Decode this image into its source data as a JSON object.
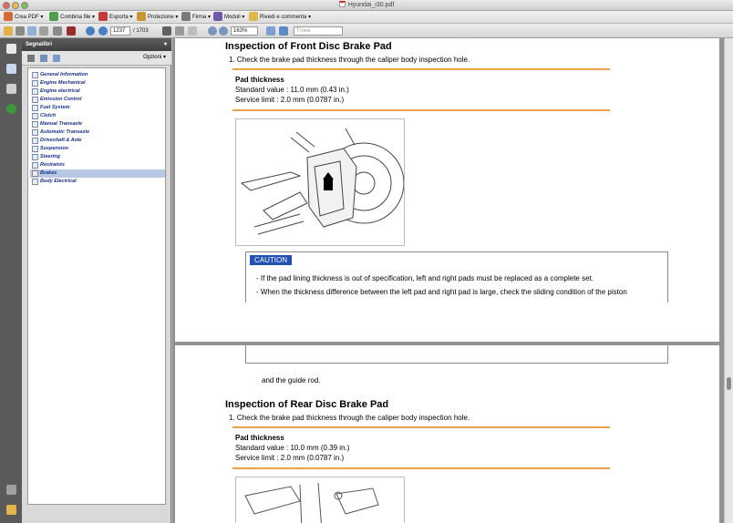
{
  "window": {
    "title": "Hyundai_i30.pdf"
  },
  "toolbar": {
    "create_pdf": "Crea PDF ▾",
    "combine": "Combina file ▾",
    "export": "Esporta ▾",
    "protect": "Protezione ▾",
    "sign": "Firma ▾",
    "forms": "Moduli ▾",
    "review": "Rivedi e commenta ▾"
  },
  "nav": {
    "current_page": "1237",
    "page_total": "/ 1703",
    "zoom": "163%",
    "search_placeholder": "Trova"
  },
  "bookmarks": {
    "header": "Segnalibri",
    "options": "Opzioni ▾",
    "items": [
      {
        "label": "General Information"
      },
      {
        "label": "Engine Mechanical"
      },
      {
        "label": "Engine electrical"
      },
      {
        "label": "Emission Control"
      },
      {
        "label": "Fuel System"
      },
      {
        "label": "Clutch"
      },
      {
        "label": "Manual Transaxle"
      },
      {
        "label": "Automatic Transaxle"
      },
      {
        "label": "Driveshaft & Axle"
      },
      {
        "label": "Suspension"
      },
      {
        "label": "Steering"
      },
      {
        "label": "Restraints"
      },
      {
        "label": "Brakes",
        "selected": true
      },
      {
        "label": "Body Electrical"
      }
    ]
  },
  "page1": {
    "title": "Inspection of Front Disc Brake Pad",
    "step": "1. Check the brake pad thickness through the caliper body inspection hole.",
    "pad_heading": "Pad thickness",
    "standard": "Standard value : 11.0 mm (0.43 in.)",
    "limit": "Service limit : 2.0 mm (0.0787 in.)",
    "caution_tag": "CAUTION",
    "caution_line1": "- If the pad lining thickness is out of specification, left and right pads must be replaced as a complete set.",
    "caution_line2": "- When the thickness difference between the left pad and right pad is large, check the sliding condition of the piston"
  },
  "page2": {
    "continuation": "and the guide rod.",
    "title": "Inspection of Rear Disc Brake Pad",
    "step": "1. Check the brake pad thickness through the caliper body inspection hole.",
    "pad_heading": "Pad thickness",
    "standard": "Standard value : 10.0 mm (0.39 in.)",
    "limit": "Service limit : 2.0 mm (0.0787 in.)"
  },
  "colors": {
    "rule": "#e8a24a",
    "caution_bg": "#2250b3",
    "bookmark_text": "#16308c",
    "selected_bg": "#b7c9e4"
  }
}
